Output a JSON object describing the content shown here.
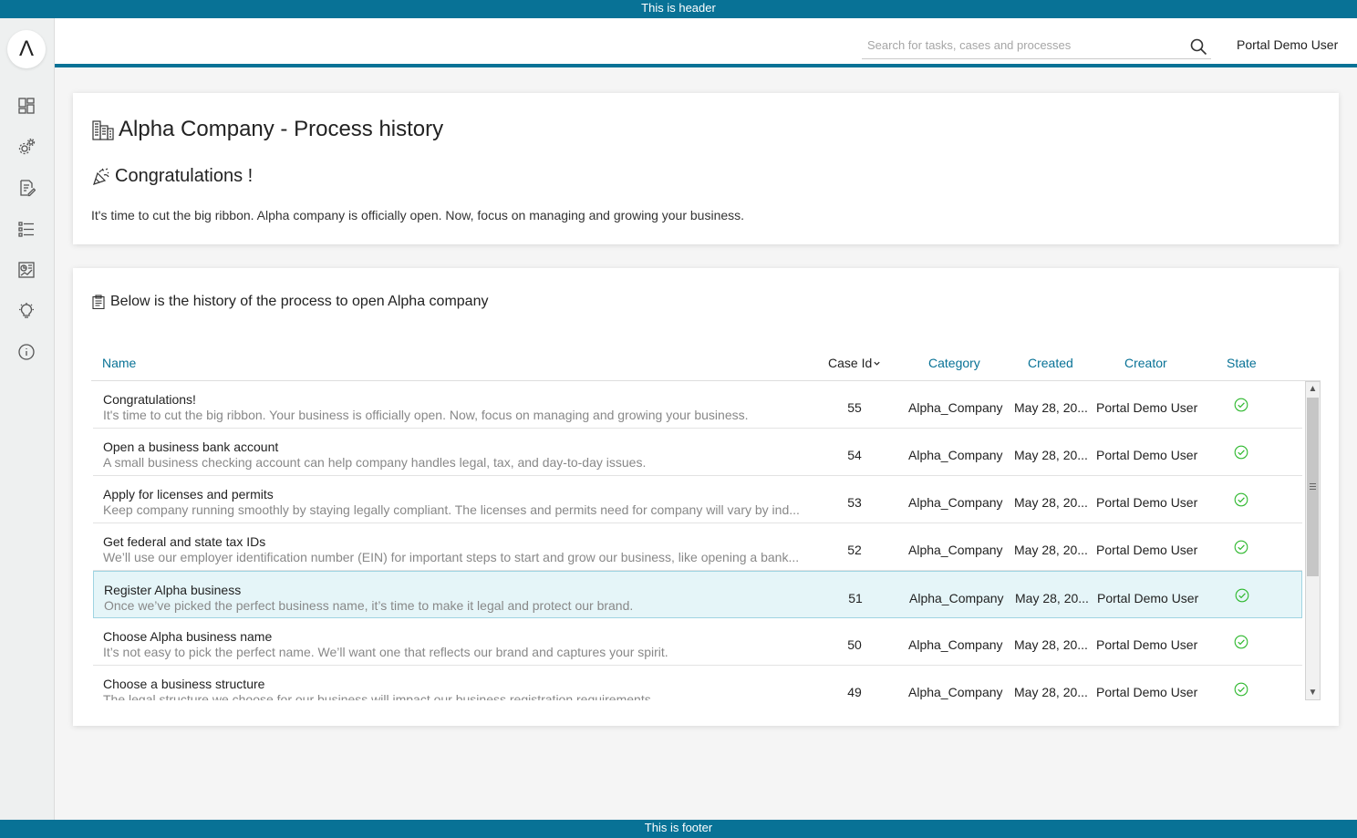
{
  "header_text": "This is header",
  "footer_text": "This is footer",
  "logo_glyph": "Λ",
  "sidebar": {
    "items": [
      {
        "icon": "dashboard-icon"
      },
      {
        "icon": "processes-gear-icon"
      },
      {
        "icon": "tasks-icon"
      },
      {
        "icon": "cases-list-icon"
      },
      {
        "icon": "statistics-icon"
      },
      {
        "icon": "ideas-bulb-icon"
      },
      {
        "icon": "info-icon"
      }
    ]
  },
  "topbar": {
    "search_placeholder": "Search for tasks, cases and processes",
    "search_value": "",
    "user": "Portal Demo User"
  },
  "intro": {
    "title": "Alpha Company - Process history",
    "subtitle": "Congratulations !",
    "text": "It's time to cut the big ribbon. Alpha company is officially open. Now, focus on managing and growing your business."
  },
  "history": {
    "title": "Below is the history of the process to open Alpha company",
    "columns": {
      "name": "Name",
      "case_id": "Case Id",
      "category": "Category",
      "created": "Created",
      "creator": "Creator",
      "state": "State"
    },
    "sorted_column": "case_id",
    "rows": [
      {
        "name": "Congratulations!",
        "desc": "It's time to cut the big ribbon. Your business is officially open. Now, focus on managing and growing your business.",
        "case_id": "55",
        "category": "Alpha_Company",
        "created": "May 28, 20...",
        "creator": "Portal Demo User",
        "state": "done"
      },
      {
        "name": "Open a business bank account",
        "desc": "A small business checking account can help company handles legal, tax, and day-to-day issues.",
        "case_id": "54",
        "category": "Alpha_Company",
        "created": "May 28, 20...",
        "creator": "Portal Demo User",
        "state": "done"
      },
      {
        "name": "Apply for licenses and permits",
        "desc": "Keep company running smoothly by staying legally compliant. The licenses and permits need for company will vary by ind...",
        "case_id": "53",
        "category": "Alpha_Company",
        "created": "May 28, 20...",
        "creator": "Portal Demo User",
        "state": "done"
      },
      {
        "name": "Get federal and state tax IDs",
        "desc": "We’ll use our employer identification number (EIN) for important steps to start and grow our business, like opening a bank...",
        "case_id": "52",
        "category": "Alpha_Company",
        "created": "May 28, 20...",
        "creator": "Portal Demo User",
        "state": "done"
      },
      {
        "name": "Register Alpha business",
        "desc": "Once we’ve picked the perfect business name, it’s time to make it legal and protect our brand.",
        "case_id": "51",
        "category": "Alpha_Company",
        "created": "May 28, 20...",
        "creator": "Portal Demo User",
        "state": "done",
        "selected": true
      },
      {
        "name": "Choose Alpha business name",
        "desc": "It’s not easy to pick the perfect name. We’ll want one that reflects our brand and captures your spirit.",
        "case_id": "50",
        "category": "Alpha_Company",
        "created": "May 28, 20...",
        "creator": "Portal Demo User",
        "state": "done"
      },
      {
        "name": "Choose a business structure",
        "desc": "The legal structure we choose for our business will impact our business registration requirements",
        "case_id": "49",
        "category": "Alpha_Company",
        "created": "May 28, 20...",
        "creator": "Portal Demo User",
        "state": "done"
      }
    ]
  },
  "colors": {
    "brand": "#087296",
    "state_done": "#2eb82e",
    "selected_row": "#e5f5f8"
  }
}
